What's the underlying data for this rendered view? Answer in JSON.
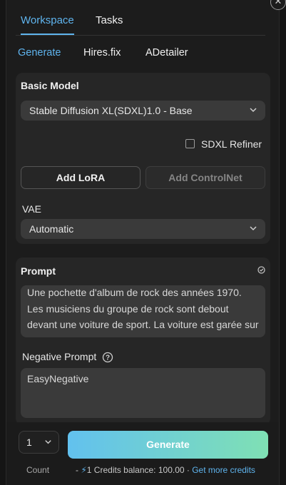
{
  "top_tabs": [
    "Workspace",
    "Tasks"
  ],
  "sub_tabs": [
    "Generate",
    "Hires.fix",
    "ADetailer"
  ],
  "basic_model": {
    "title": "Basic Model",
    "model_select": "Stable Diffusion XL(SDXL)1.0 - Base",
    "refiner_label": "SDXL Refiner",
    "add_lora": "Add LoRA",
    "add_controlnet": "Add ControlNet",
    "vae_label": "VAE",
    "vae_select": "Automatic"
  },
  "prompt": {
    "title": "Prompt",
    "text": "Une pochette d'album de rock des années 1970. Les musiciens du groupe de rock sont debout devant une voiture de sport. La voiture est garée sur le chemin d'un pont. Style photo réaliste.",
    "negative_label": "Negative Prompt",
    "negative_text": "EasyNegative"
  },
  "bottom": {
    "count_value": "1",
    "generate_label": "Generate",
    "count_label": "Count",
    "credits_prefix": "- ",
    "credits_cost": "1",
    "credits_text": " Credits balance: 100.00 · ",
    "get_more_credits": "Get more credits"
  },
  "colors": {
    "accent": "#5fb4ee",
    "generate_gradient_start": "#62c1ee",
    "generate_gradient_end": "#7fe0b4"
  }
}
